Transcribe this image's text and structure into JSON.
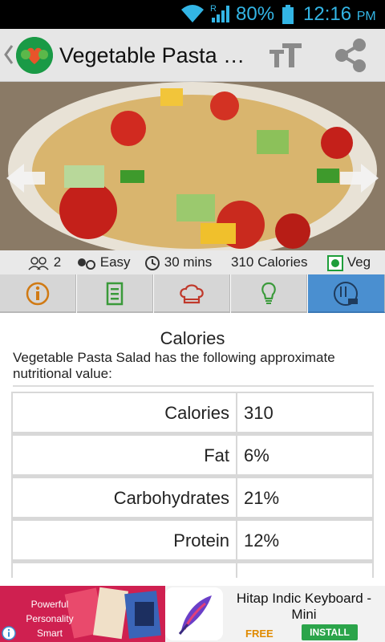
{
  "status_bar": {
    "battery_percent": "80%",
    "time": "12:16",
    "ampm": "PM",
    "signal_label": "R",
    "icons": [
      "wifi-icon",
      "signal-icon",
      "battery-icon"
    ]
  },
  "app_bar": {
    "title": "Vegetable Pasta Salad",
    "icons": [
      "back-icon",
      "app-logo",
      "text-size-icon",
      "share-icon"
    ]
  },
  "hero": {
    "icons": [
      "prev-arrow-icon",
      "next-arrow-icon"
    ]
  },
  "recipe_info": {
    "servings": "2",
    "difficulty": "Easy",
    "time": "30 mins",
    "calories": "310 Calories",
    "diet": "Veg"
  },
  "tabs": [
    {
      "icon": "info-icon",
      "active": false
    },
    {
      "icon": "ingredients-list-icon",
      "active": false
    },
    {
      "icon": "chef-hat-icon",
      "active": false
    },
    {
      "icon": "lightbulb-tip-icon",
      "active": false
    },
    {
      "icon": "nutrition-kcal-icon",
      "active": true
    }
  ],
  "nutrition": {
    "title": "Calories",
    "description": "Vegetable Pasta Salad has the following approximate nutritional value:",
    "rows": [
      {
        "label": "Calories",
        "value": "310"
      },
      {
        "label": "Fat",
        "value": "6%"
      },
      {
        "label": "Carbohydrates",
        "value": "21%"
      },
      {
        "label": "Protein",
        "value": "12%"
      }
    ]
  },
  "ad": {
    "banner_text": "Powerful Personality Smart",
    "app_title": "Hitap Indic Keyboard - Mini",
    "price": "FREE",
    "install_label": "INSTALL"
  },
  "colors": {
    "accent": "#33b5e5",
    "active_tab": "#4a8fd0",
    "veg_green": "#1e9e3a",
    "install_green": "#2ba44a"
  }
}
